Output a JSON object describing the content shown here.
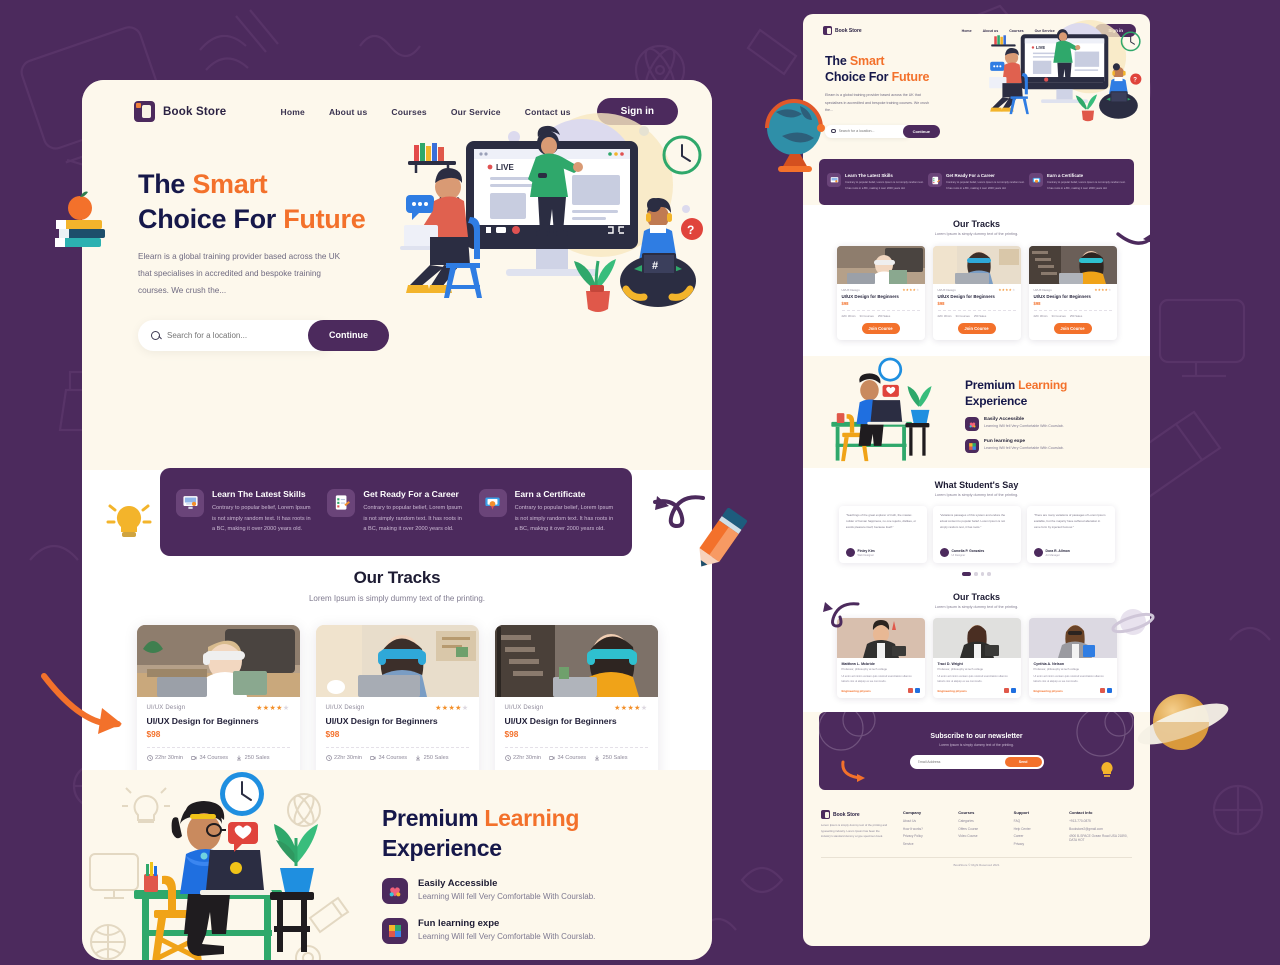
{
  "theme": {
    "bg_purple": "#4c2a5d",
    "cream": "#fdf8ec",
    "orange": "#f3712b",
    "navy": "#16184a"
  },
  "nav": {
    "brand": "Book Store",
    "links": [
      "Home",
      "About us",
      "Courses",
      "Our Service",
      "Contact us"
    ],
    "signin": "Sign in"
  },
  "hero": {
    "title_1": "The ",
    "title_hl_1": "Smart",
    "title_2": "Choice For ",
    "title_hl_2": "Future",
    "paragraph": "Elearn is a global training provider based across the UK that specialises in accredited and bespoke training courses. We crush the...",
    "search_placeholder": "Search for a location...",
    "search_value": "",
    "continue": "Continue"
  },
  "features": [
    {
      "title": "Learn The Latest Skills",
      "desc": "Contrary to popular belief, Lorem Ipsum is not simply random text. It has roots in a BC, making it over 2000 years old.",
      "icon": "monitor-learning-icon"
    },
    {
      "title": "Get Ready For a Career",
      "desc": "Contrary to popular belief, Lorem Ipsum is not simply random text. It has roots in a BC, making it over 2000 years old.",
      "icon": "checklist-icon"
    },
    {
      "title": "Earn a Certificate",
      "desc": "Contrary to popular belief, Lorem Ipsum is not simply random text. It has roots in a BC, making it over 2000 years old.",
      "icon": "certificate-icon"
    }
  ],
  "tracks": {
    "title": "Our Tracks",
    "subtitle": "Lorem Ipsum is simply dummy text of the printing.",
    "cards": [
      {
        "category": "UI/UX Design",
        "title": "UI/UX Design for Beginners",
        "price": "$98",
        "rating": 4,
        "duration": "22hr 30min",
        "courses": "34 Courses",
        "sales": "250 Sales",
        "cta": "Join Course"
      },
      {
        "category": "UI/UX Design",
        "title": "UI/UX Design for Beginners",
        "price": "$98",
        "rating": 4,
        "duration": "22hr 30min",
        "courses": "34 Courses",
        "sales": "250 Sales",
        "cta": "Join Course"
      },
      {
        "category": "UI/UX Design",
        "title": "UI/UX Design for Beginners",
        "price": "$98",
        "rating": 4,
        "duration": "22hr 30min",
        "courses": "34 Courses",
        "sales": "250 Sales",
        "cta": "Join Course"
      }
    ]
  },
  "premium": {
    "title_1": "Premium ",
    "title_hl": "Learning",
    "title_2": "Experience",
    "items": [
      {
        "title": "Easily Accessible",
        "desc": "Learning Will fell Very Comfortable With Courslab.",
        "icon": "heart-icon"
      },
      {
        "title": "Fun learning expe",
        "desc": "Learning Will fell Very Comfortable With Courslab.",
        "icon": "puzzle-icon"
      }
    ]
  },
  "testimonials": {
    "title": "What Student's Say",
    "subtitle": "Lorem Ipsum is simply dummy text of the printing.",
    "cards": [
      {
        "quote": "\"Teachings of the great explorer of truth, the master-builder of human happiness, no one rejects, dislikes, or avoids pleasure itself, because itself.\"",
        "name": "Finley Kim",
        "role": "Web Designer"
      },
      {
        "quote": "\"Variations passages of this system and endure the actual content to popular belief. Lorem Ipsum is not simply random text, it has roots.\"",
        "name": "Camelia P. Gonzales",
        "role": "UI Designer"
      },
      {
        "quote": "\"There are many variations of passages of Lorem Ipsum available, but the majority have suffered alteration in some form by injected humour.\"",
        "name": "Dora R. Allmon",
        "role": "Art Manager"
      }
    ],
    "dots": 4,
    "active_dot": 0
  },
  "team": {
    "title": "Our Tracks",
    "subtitle": "Lorem Ipsum is simply dummy text of the printing.",
    "members": [
      {
        "name": "Matthew L. Mcbride",
        "role": "Professor, philosophy at tech college",
        "desc": "Ut enim ad minim veniam quis nostrud exercitation ullamco laboris nisi ut aliquip ex ea commodo.",
        "tag": "Engineering physics"
      },
      {
        "name": "Traci D. Wright",
        "role": "Professor, philosophy at tech college",
        "desc": "Ut enim ad minim veniam quis nostrud exercitation ullamco laboris nisi ut aliquip ex ea commodo.",
        "tag": "Engineering physics"
      },
      {
        "name": "Cynthia A. Nelson",
        "role": "Professor, philosophy at tech college",
        "desc": "Ut enim ad minim veniam quis nostrud exercitation ullamco laboris nisi ut aliquip ex ea commodo.",
        "tag": "Engineering physics"
      }
    ]
  },
  "newsletter": {
    "title": "Subscribe to our newsletter",
    "subtitle": "Lorem Ipsum is simply dummy text of the printing.",
    "placeholder": "Email Address",
    "value": "",
    "button": "Send"
  },
  "footer": {
    "brand": "Book Store",
    "about": "Lorem Ipsum is simply dummy text of the printing and typesetting industry. Lorem Ipsum has been the industry's standard dummy a type specimen book.",
    "columns": [
      {
        "title": "Company",
        "items": [
          "About Us",
          "How It works?",
          "Privacy Policy",
          "Service"
        ]
      },
      {
        "title": "Courses",
        "items": [
          "Categories",
          "Offers Course",
          "Video Course"
        ]
      },
      {
        "title": "Support",
        "items": [
          "FAQ",
          "Help Center",
          "Career",
          "Privacy"
        ]
      }
    ],
    "contact_title": "Contact Info",
    "contact": [
      "+913-770-0875",
      "Bookstore2@gmail.com",
      "4900 B-SPACE Ocean Road USA 21890, DATA HOT"
    ],
    "copyright": "BookStore © Right Reserved 2021"
  }
}
